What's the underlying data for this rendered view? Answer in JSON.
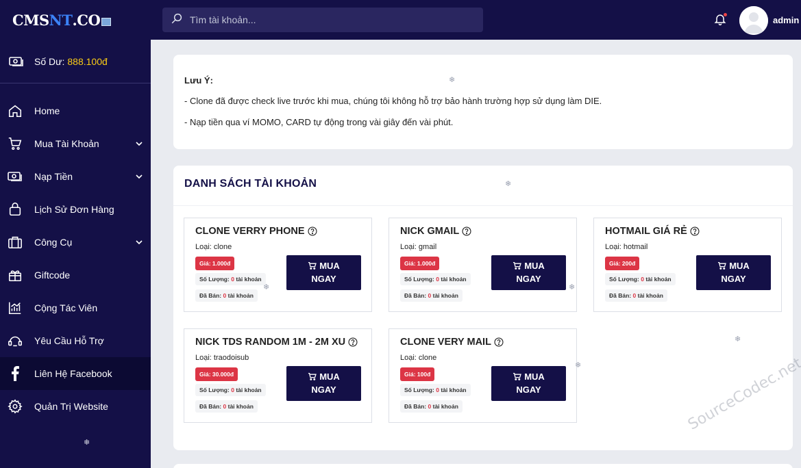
{
  "brand": {
    "part1": "CMS",
    "part2": "NT",
    "part3": ".CO"
  },
  "balance": {
    "label": "Số Dư:",
    "amount": "888.100đ"
  },
  "nav": [
    {
      "label": "Home",
      "icon": "home-icon",
      "has_chevron": false
    },
    {
      "label": "Mua Tài Khoản",
      "icon": "cart-icon",
      "has_chevron": true
    },
    {
      "label": "Nạp Tiền",
      "icon": "money-icon",
      "has_chevron": true
    },
    {
      "label": "Lịch Sử Đơn Hàng",
      "icon": "bag-icon",
      "has_chevron": false
    },
    {
      "label": "Công Cụ",
      "icon": "toolbox-icon",
      "has_chevron": true
    },
    {
      "label": "Giftcode",
      "icon": "gift-icon",
      "has_chevron": false
    },
    {
      "label": "Cộng Tác Viên",
      "icon": "chart-icon",
      "has_chevron": false
    },
    {
      "label": "Yêu Cầu Hỗ Trợ",
      "icon": "support-icon",
      "has_chevron": false
    },
    {
      "label": "Liên Hệ Facebook",
      "icon": "facebook-icon",
      "has_chevron": false
    },
    {
      "label": "Quản Trị Website",
      "icon": "gear-icon",
      "has_chevron": false
    }
  ],
  "search": {
    "placeholder": "Tìm tài khoản..."
  },
  "user": {
    "name": "admin"
  },
  "notice": {
    "title": "Lưu Ý:",
    "lines": [
      "- Clone đã được check live trước khi mua, chúng tôi không hỗ trợ bảo hành trường hợp sử dụng làm DIE.",
      "- Nạp tiền qua ví MOMO, CARD tự động trong vài giây đến vài phút."
    ]
  },
  "list": {
    "heading": "DANH SÁCH TÀI KHOẢN",
    "buy_line1": "MUA",
    "buy_line2": "NGAY",
    "qty_label": "Số Lượng:",
    "sold_label": "Đã Bán:",
    "unit": "tài khoản",
    "products": [
      {
        "name": "CLONE VERRY PHONE",
        "type": "Loại: clone",
        "price": "Giá: 1.000đ",
        "qty": "0",
        "sold": "0"
      },
      {
        "name": "NICK GMAIL",
        "type": "Loại: gmail",
        "price": "Giá: 1.000đ",
        "qty": "0",
        "sold": "0"
      },
      {
        "name": "HOTMAIL GIÁ RẺ",
        "type": "Loại: hotmail",
        "price": "Giá: 200đ",
        "qty": "0",
        "sold": "0"
      },
      {
        "name": "NICK TDS RANDOM 1M - 2M XU",
        "type": "Loại: traodoisub",
        "price": "Giá: 30.000đ",
        "qty": "0",
        "sold": "0"
      },
      {
        "name": "CLONE VERY MAIL",
        "type": "Loại: clone",
        "price": "Giá: 100đ",
        "qty": "0",
        "sold": "0"
      }
    ]
  },
  "watermark": "SourceCodec.net",
  "colors": {
    "sidebar": "#141047",
    "accent_yellow": "#facc15",
    "price_red": "#dc3545",
    "button": "#141047"
  }
}
